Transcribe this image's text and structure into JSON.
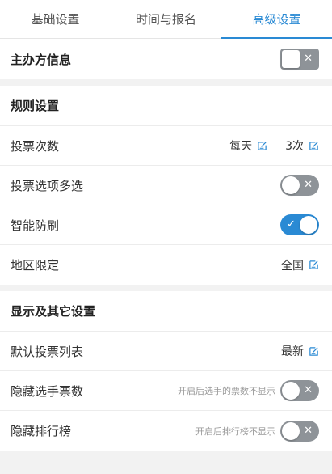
{
  "tabs": [
    {
      "label": "基础设置",
      "active": false
    },
    {
      "label": "时间与报名",
      "active": false
    },
    {
      "label": "高级设置",
      "active": true
    }
  ],
  "organizer": {
    "label": "主办方信息",
    "enabled": false
  },
  "rules": {
    "title": "规则设置",
    "vote_count": {
      "label": "投票次数",
      "period": "每天",
      "times": "3次"
    },
    "multi_select": {
      "label": "投票选项多选",
      "enabled": false
    },
    "anti_spam": {
      "label": "智能防刷",
      "enabled": true
    },
    "region": {
      "label": "地区限定",
      "value": "全国"
    }
  },
  "display": {
    "title": "显示及其它设置",
    "default_list": {
      "label": "默认投票列表",
      "value": "最新"
    },
    "hide_votes": {
      "label": "隐藏选手票数",
      "hint": "开启后选手的票数不显示",
      "enabled": false
    },
    "hide_ranking": {
      "label": "隐藏排行榜",
      "hint": "开启后排行榜不显示",
      "enabled": false
    }
  },
  "colors": {
    "accent": "#2a8ad4",
    "toggle_off": "#8e9398"
  },
  "icons": {
    "edit": "edit-icon",
    "check": "check-icon",
    "close": "close-icon"
  }
}
